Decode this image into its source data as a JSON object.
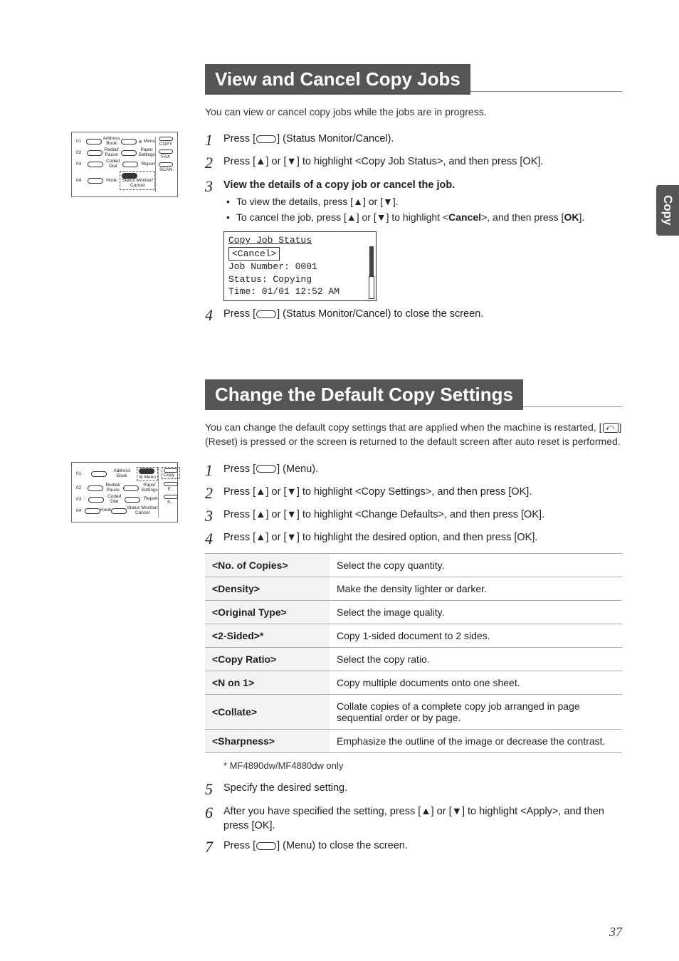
{
  "side_tab": "Copy",
  "page_number": "37",
  "section1": {
    "title": "View and Cancel Copy Jobs",
    "intro": "You can view or cancel copy jobs while the jobs are in progress.",
    "steps": {
      "s1a": "Press [",
      "s1b": "] (Status Monitor/Cancel).",
      "s2": "Press [▲] or [▼] to highlight <Copy Job Status>, and then press [OK].",
      "s3": "View the details of a copy job or cancel the job.",
      "s3b1": "To view the details, press [▲] or [▼].",
      "s3b2a": "To cancel the job, press [▲] or [▼] to highlight <",
      "s3b2b": "Cancel",
      "s3b2c": ">, and then press [",
      "s3b2d": "OK",
      "s3b2e": "].",
      "s4a": "Press [",
      "s4b": "] (Status Monitor/Cancel) to close the screen."
    },
    "lcd": {
      "l1": "Copy Job Status",
      "l2": "<Cancel>",
      "l3": "Job Number: 0001",
      "l4": "Status: Copying",
      "l5": "Time: 01/01 12:52 AM"
    }
  },
  "section2": {
    "title": "Change the Default Copy Settings",
    "intro_a": "You can change the default copy settings that are applied when the machine is restarted, [",
    "intro_b": "] (Reset) is pressed or the screen is returned to the default screen after auto reset is performed.",
    "steps": {
      "s1a": "Press [",
      "s1b": "] (Menu).",
      "s2": "Press [▲] or [▼] to highlight <Copy Settings>, and then press [OK].",
      "s3": "Press [▲] or [▼] to highlight <Change Defaults>, and then press [OK].",
      "s4": "Press [▲] or [▼] to highlight the desired option, and then press [OK].",
      "s5": "Specify the desired setting.",
      "s6": "After you have specified the setting, press [▲] or [▼] to highlight <Apply>, and then press [OK].",
      "s7a": "Press [",
      "s7b": "] (Menu) to close the screen."
    },
    "table": [
      {
        "k": "<No. of Copies>",
        "v": "Select the copy quantity."
      },
      {
        "k": "<Density>",
        "v": "Make the density lighter or darker."
      },
      {
        "k": "<Original Type>",
        "v": "Select the image quality."
      },
      {
        "k": "<2-Sided>*",
        "v": "Copy 1-sided document to 2 sides."
      },
      {
        "k": "<Copy Ratio>",
        "v": "Select the copy ratio."
      },
      {
        "k": "<N on 1>",
        "v": "Copy multiple documents onto one sheet."
      },
      {
        "k": "<Collate>",
        "v": "Collate copies of a complete copy job arranged in page sequential order or by page."
      },
      {
        "k": "<Sharpness>",
        "v": "Emphasize the outline of the image or decrease the contrast."
      }
    ],
    "footnote": "*  MF4890dw/MF4880dw only"
  },
  "device_labels": {
    "address_book": "Address\nBook",
    "menu": "Menu",
    "redial_pause": "Redial/\nPause",
    "paper_settings": "Paper\nSettings",
    "coded_dial": "Coded\nDial",
    "report": "Report",
    "hook": "Hook",
    "status_monitor": "Status Monitor/\nCancel",
    "copy": "COPY",
    "copy_low": "Copy",
    "fax": "FAX",
    "scan": "SCAN"
  }
}
